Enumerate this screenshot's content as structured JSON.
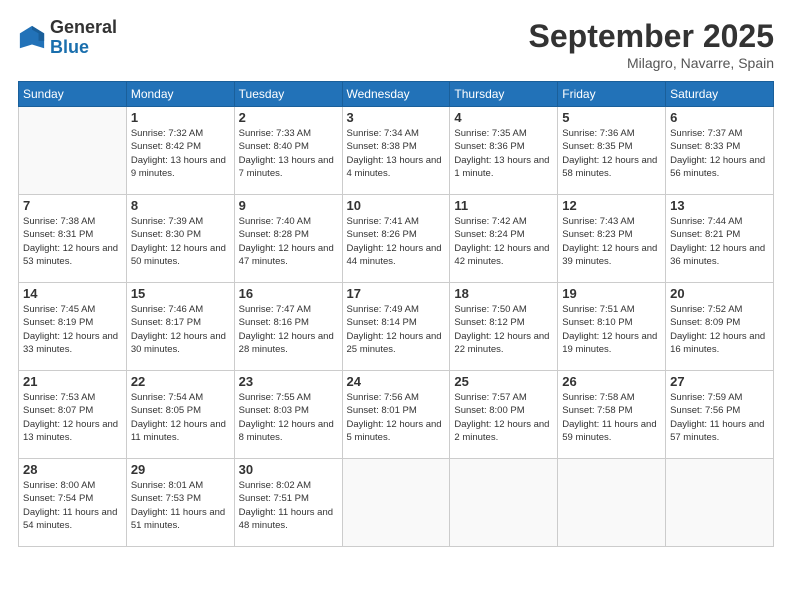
{
  "header": {
    "logo_general": "General",
    "logo_blue": "Blue",
    "month_title": "September 2025",
    "location": "Milagro, Navarre, Spain"
  },
  "weekdays": [
    "Sunday",
    "Monday",
    "Tuesday",
    "Wednesday",
    "Thursday",
    "Friday",
    "Saturday"
  ],
  "weeks": [
    [
      {
        "day": "",
        "info": ""
      },
      {
        "day": "1",
        "info": "Sunrise: 7:32 AM\nSunset: 8:42 PM\nDaylight: 13 hours\nand 9 minutes."
      },
      {
        "day": "2",
        "info": "Sunrise: 7:33 AM\nSunset: 8:40 PM\nDaylight: 13 hours\nand 7 minutes."
      },
      {
        "day": "3",
        "info": "Sunrise: 7:34 AM\nSunset: 8:38 PM\nDaylight: 13 hours\nand 4 minutes."
      },
      {
        "day": "4",
        "info": "Sunrise: 7:35 AM\nSunset: 8:36 PM\nDaylight: 13 hours\nand 1 minute."
      },
      {
        "day": "5",
        "info": "Sunrise: 7:36 AM\nSunset: 8:35 PM\nDaylight: 12 hours\nand 58 minutes."
      },
      {
        "day": "6",
        "info": "Sunrise: 7:37 AM\nSunset: 8:33 PM\nDaylight: 12 hours\nand 56 minutes."
      }
    ],
    [
      {
        "day": "7",
        "info": "Sunrise: 7:38 AM\nSunset: 8:31 PM\nDaylight: 12 hours\nand 53 minutes."
      },
      {
        "day": "8",
        "info": "Sunrise: 7:39 AM\nSunset: 8:30 PM\nDaylight: 12 hours\nand 50 minutes."
      },
      {
        "day": "9",
        "info": "Sunrise: 7:40 AM\nSunset: 8:28 PM\nDaylight: 12 hours\nand 47 minutes."
      },
      {
        "day": "10",
        "info": "Sunrise: 7:41 AM\nSunset: 8:26 PM\nDaylight: 12 hours\nand 44 minutes."
      },
      {
        "day": "11",
        "info": "Sunrise: 7:42 AM\nSunset: 8:24 PM\nDaylight: 12 hours\nand 42 minutes."
      },
      {
        "day": "12",
        "info": "Sunrise: 7:43 AM\nSunset: 8:23 PM\nDaylight: 12 hours\nand 39 minutes."
      },
      {
        "day": "13",
        "info": "Sunrise: 7:44 AM\nSunset: 8:21 PM\nDaylight: 12 hours\nand 36 minutes."
      }
    ],
    [
      {
        "day": "14",
        "info": "Sunrise: 7:45 AM\nSunset: 8:19 PM\nDaylight: 12 hours\nand 33 minutes."
      },
      {
        "day": "15",
        "info": "Sunrise: 7:46 AM\nSunset: 8:17 PM\nDaylight: 12 hours\nand 30 minutes."
      },
      {
        "day": "16",
        "info": "Sunrise: 7:47 AM\nSunset: 8:16 PM\nDaylight: 12 hours\nand 28 minutes."
      },
      {
        "day": "17",
        "info": "Sunrise: 7:49 AM\nSunset: 8:14 PM\nDaylight: 12 hours\nand 25 minutes."
      },
      {
        "day": "18",
        "info": "Sunrise: 7:50 AM\nSunset: 8:12 PM\nDaylight: 12 hours\nand 22 minutes."
      },
      {
        "day": "19",
        "info": "Sunrise: 7:51 AM\nSunset: 8:10 PM\nDaylight: 12 hours\nand 19 minutes."
      },
      {
        "day": "20",
        "info": "Sunrise: 7:52 AM\nSunset: 8:09 PM\nDaylight: 12 hours\nand 16 minutes."
      }
    ],
    [
      {
        "day": "21",
        "info": "Sunrise: 7:53 AM\nSunset: 8:07 PM\nDaylight: 12 hours\nand 13 minutes."
      },
      {
        "day": "22",
        "info": "Sunrise: 7:54 AM\nSunset: 8:05 PM\nDaylight: 12 hours\nand 11 minutes."
      },
      {
        "day": "23",
        "info": "Sunrise: 7:55 AM\nSunset: 8:03 PM\nDaylight: 12 hours\nand 8 minutes."
      },
      {
        "day": "24",
        "info": "Sunrise: 7:56 AM\nSunset: 8:01 PM\nDaylight: 12 hours\nand 5 minutes."
      },
      {
        "day": "25",
        "info": "Sunrise: 7:57 AM\nSunset: 8:00 PM\nDaylight: 12 hours\nand 2 minutes."
      },
      {
        "day": "26",
        "info": "Sunrise: 7:58 AM\nSunset: 7:58 PM\nDaylight: 11 hours\nand 59 minutes."
      },
      {
        "day": "27",
        "info": "Sunrise: 7:59 AM\nSunset: 7:56 PM\nDaylight: 11 hours\nand 57 minutes."
      }
    ],
    [
      {
        "day": "28",
        "info": "Sunrise: 8:00 AM\nSunset: 7:54 PM\nDaylight: 11 hours\nand 54 minutes."
      },
      {
        "day": "29",
        "info": "Sunrise: 8:01 AM\nSunset: 7:53 PM\nDaylight: 11 hours\nand 51 minutes."
      },
      {
        "day": "30",
        "info": "Sunrise: 8:02 AM\nSunset: 7:51 PM\nDaylight: 11 hours\nand 48 minutes."
      },
      {
        "day": "",
        "info": ""
      },
      {
        "day": "",
        "info": ""
      },
      {
        "day": "",
        "info": ""
      },
      {
        "day": "",
        "info": ""
      }
    ]
  ]
}
